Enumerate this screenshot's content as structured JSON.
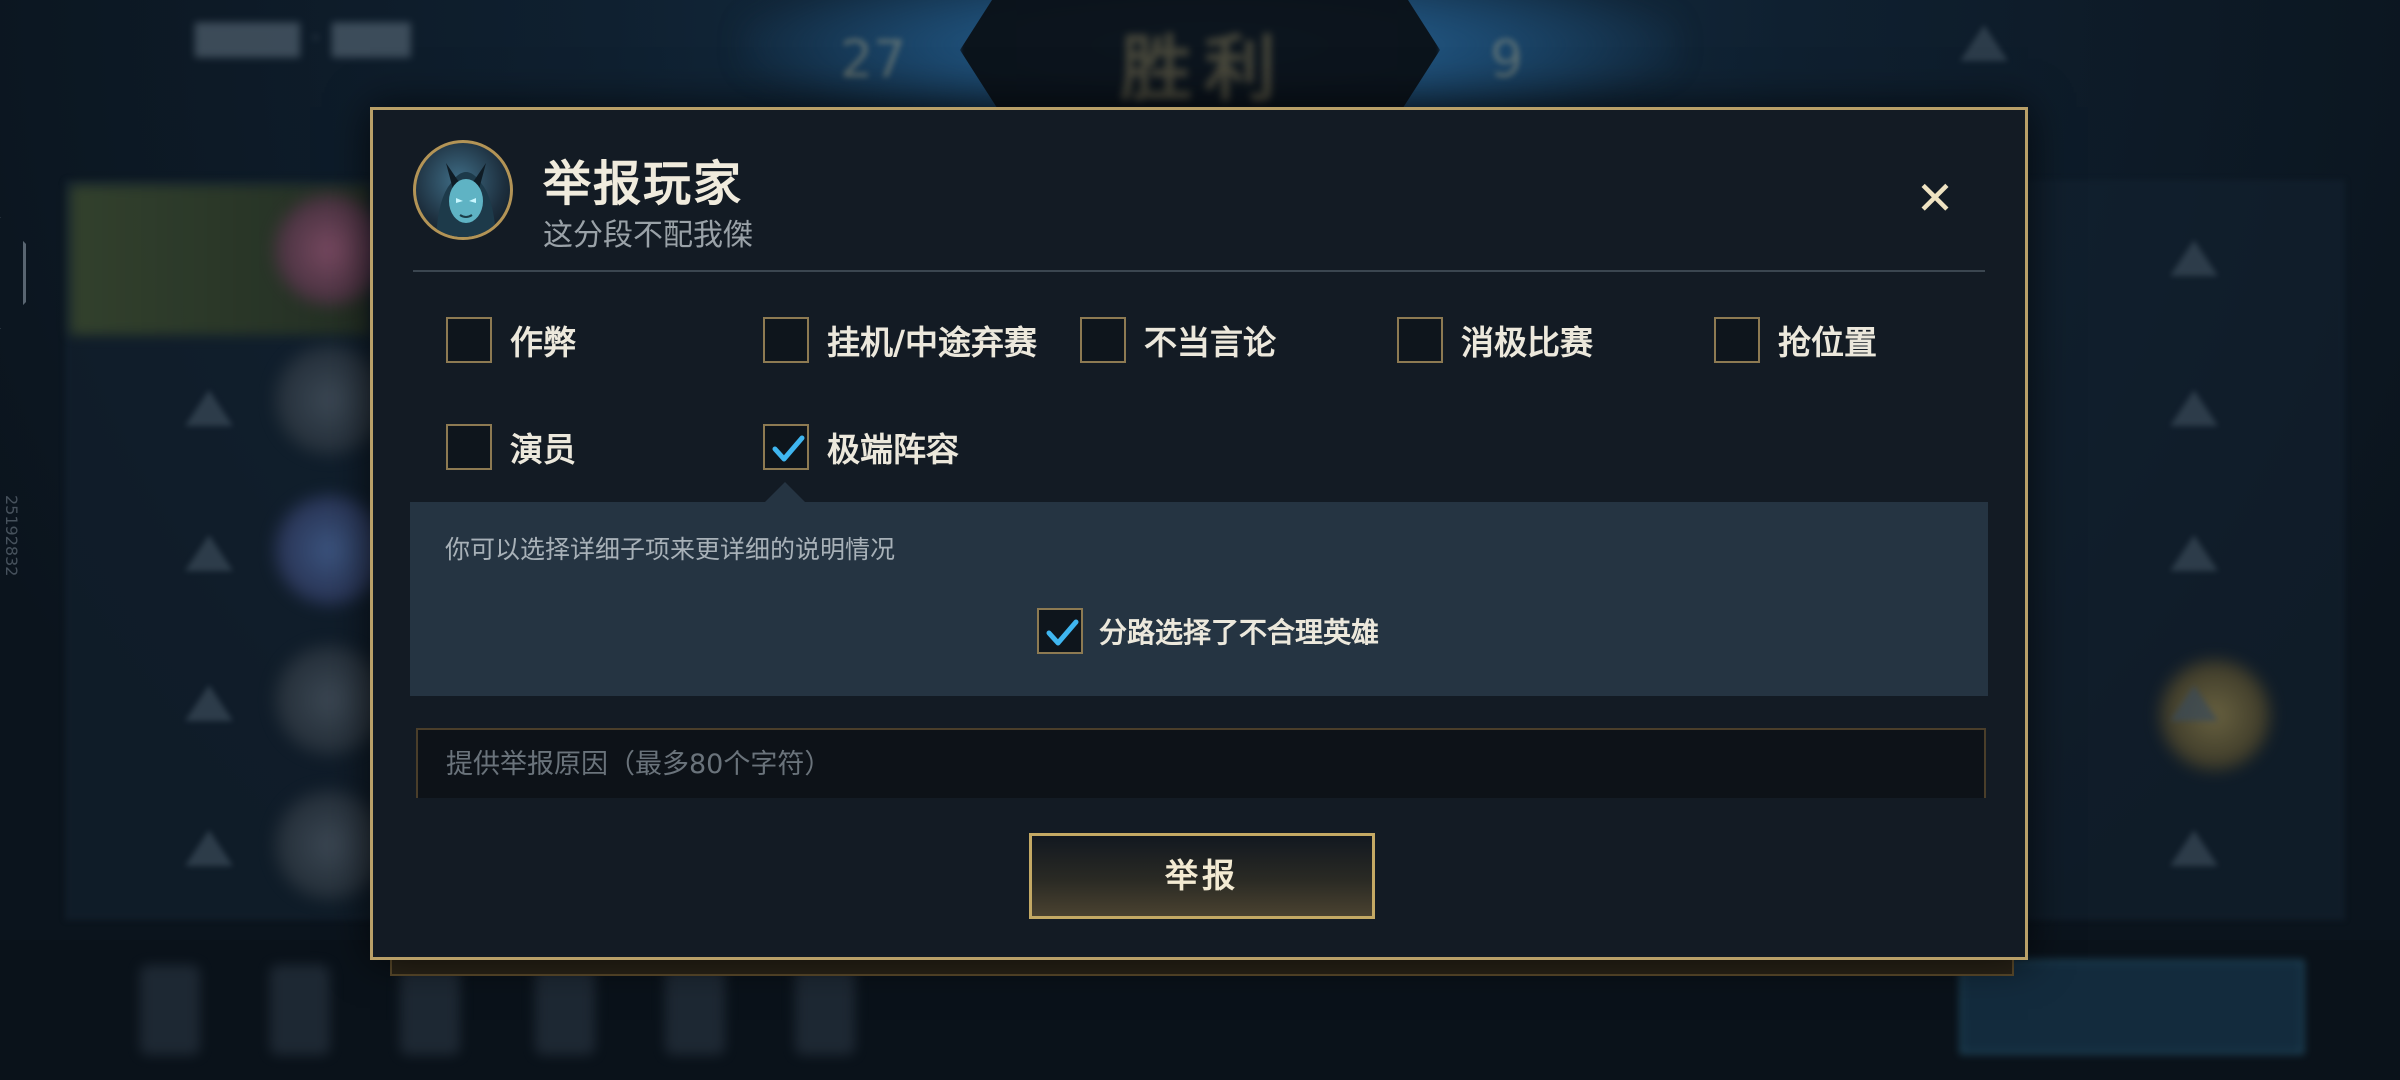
{
  "background": {
    "victory_text": "胜利",
    "score_left": "27",
    "score_right": "9",
    "side_code": "25192832"
  },
  "dialog": {
    "title": "举报玩家",
    "subtitle": "这分段不配我傑",
    "close_symbol": "✕",
    "avatar": "player-avatar",
    "options_row1": [
      {
        "label": "作弊",
        "checked": false
      },
      {
        "label": "挂机/中途弃赛",
        "checked": false
      },
      {
        "label": "不当言论",
        "checked": false
      },
      {
        "label": "消极比赛",
        "checked": false
      },
      {
        "label": "抢位置",
        "checked": false
      }
    ],
    "options_row2": [
      {
        "label": "演员",
        "checked": false
      },
      {
        "label": "极端阵容",
        "checked": true
      }
    ],
    "detail": {
      "hint": "你可以选择详细子项来更详细的说明情况",
      "sub_option": {
        "label": "分路选择了不合理英雄",
        "checked": true
      }
    },
    "reason": {
      "value": "",
      "placeholder": "提供举报原因（最多80个字符）"
    },
    "submit_label": "举报"
  },
  "colors": {
    "accent_gold": "#b9a068",
    "check_blue": "#3fb6f0",
    "dialog_bg": "#131b24",
    "detail_bg": "#253442"
  },
  "icons": [
    "close-icon",
    "checkmark-icon",
    "avatar-portrait"
  ]
}
